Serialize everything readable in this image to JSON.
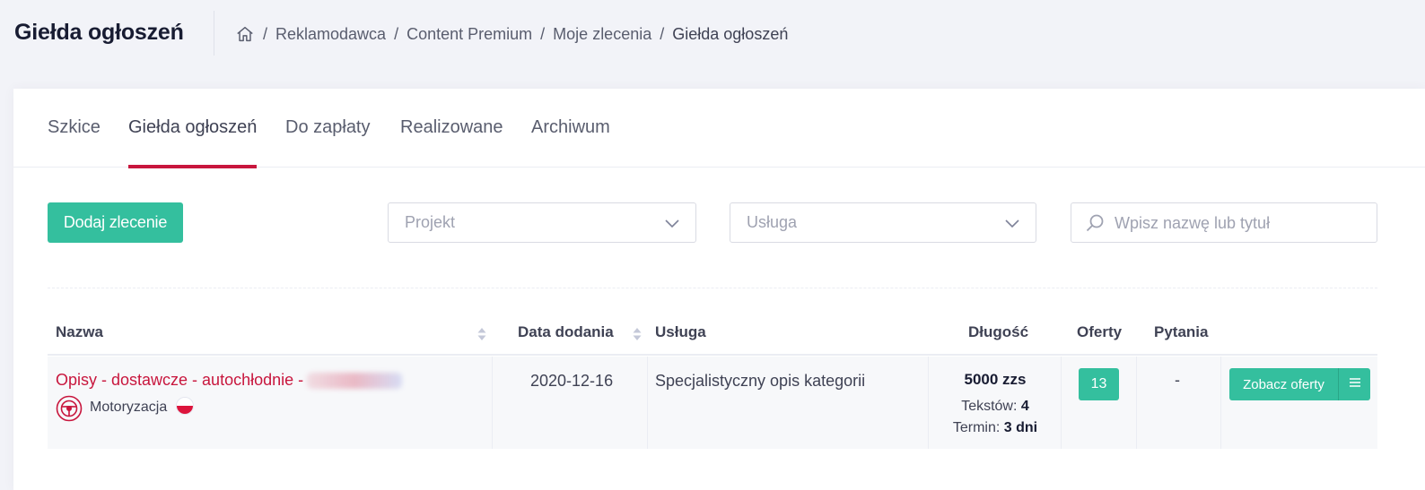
{
  "header": {
    "title": "Giełda ogłoszeń",
    "breadcrumb": [
      "Reklamodawca",
      "Content Premium",
      "Moje zlecenia",
      "Giełda ogłoszeń"
    ],
    "home_icon": "home-icon"
  },
  "tabs": [
    {
      "label": "Szkice",
      "active": false
    },
    {
      "label": "Giełda ogłoszeń",
      "active": true
    },
    {
      "label": "Do zapłaty",
      "active": false
    },
    {
      "label": "Realizowane",
      "active": false
    },
    {
      "label": "Archiwum",
      "active": false
    }
  ],
  "toolbar": {
    "add_button": "Dodaj zlecenie",
    "project_select": "Projekt",
    "service_select": "Usługa",
    "search_placeholder": "Wpisz nazwę lub tytuł"
  },
  "table": {
    "columns": [
      "Nazwa",
      "Data dodania",
      "Usługa",
      "Długość",
      "Oferty",
      "Pytania"
    ],
    "rows": [
      {
        "title": "Opisy - dostawcze - autochłodnie -",
        "category": "Motoryzacja",
        "category_icon": "steering-wheel-icon",
        "flag_icon": "poland-flag-icon",
        "date": "2020-12-16",
        "service": "Specjalistyczny opis kategorii",
        "length": "5000 zzs",
        "texts_label": "Tekstów:",
        "texts_value": "4",
        "term_label": "Termin:",
        "term_value": "3 dni",
        "offers": "13",
        "questions": "-",
        "view_button": "Zobacz oferty"
      }
    ]
  },
  "colors": {
    "accent": "#34bf9e",
    "brand_red": "#c8163d",
    "background": "#f2f3f8"
  }
}
